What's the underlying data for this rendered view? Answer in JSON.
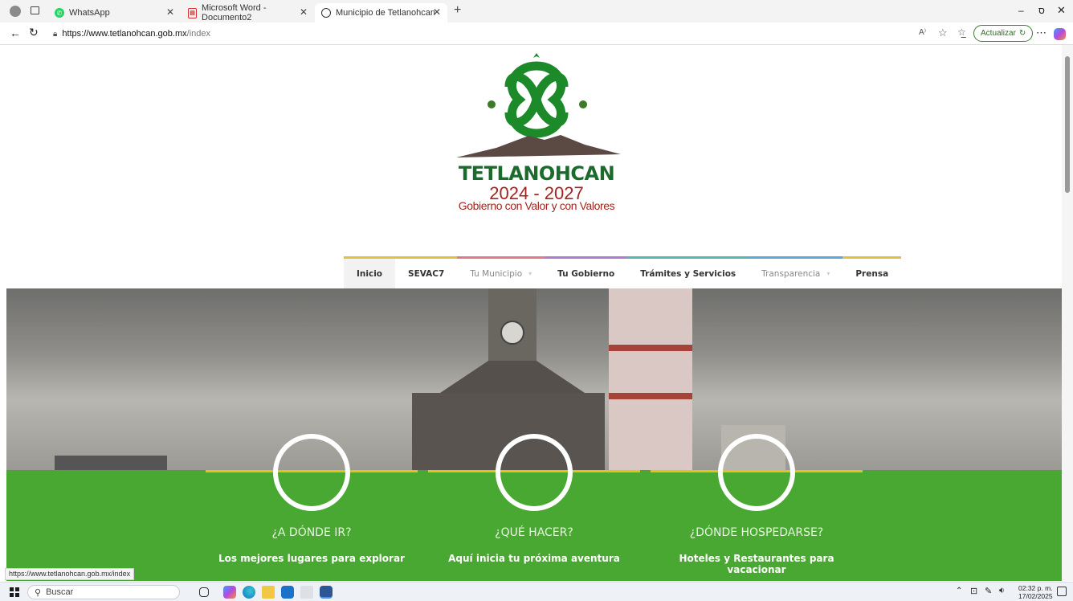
{
  "tabs": [
    {
      "title": "WhatsApp",
      "icon": "whatsapp-icon"
    },
    {
      "title": "Microsoft Word - Documento2",
      "icon": "pdf-icon"
    },
    {
      "title": "Municipio de Tetlanohcan",
      "icon": "globe-icon",
      "active": true
    }
  ],
  "address": {
    "host": "https://www.tetlanohcan.gob.mx",
    "path": "/index"
  },
  "toolbar": {
    "update_label": "Actualizar"
  },
  "logo": {
    "name": "TETLANOHCAN",
    "years": "2024 - 2027",
    "slogan": "Gobierno con Valor y con Valores"
  },
  "nav": [
    {
      "label": "Inicio",
      "color": "#e0c040"
    },
    {
      "label": "SEVAC7",
      "color": "#e0c040"
    },
    {
      "label": "Tu Municipio",
      "color": "#e07a8a",
      "dropdown": true
    },
    {
      "label": "Tu Gobierno",
      "color": "#b07ad0"
    },
    {
      "label": "Trámites y Servicios",
      "color": "#50b8b0"
    },
    {
      "label": "Transparencia",
      "color": "#5aa8d8",
      "dropdown": true
    },
    {
      "label": "Prensa",
      "color": "#e0c040"
    }
  ],
  "features": [
    {
      "title": "¿A DÓNDE IR?",
      "subtitle": "Los mejores lugares para explorar"
    },
    {
      "title": "¿QUÉ HACER?",
      "subtitle": "Aquí inicia tu próxima aventura"
    },
    {
      "title": "¿DÓNDE HOSPEDARSE?",
      "subtitle": "Hoteles y Restaurantes para vacacionar"
    }
  ],
  "status_url": "https://www.tetlanohcan.gob.mx/index",
  "taskbar": {
    "search_placeholder": "Buscar",
    "time": "02:32 p. m.",
    "date": "17/02/2025"
  },
  "colors": {
    "brand_green": "#1a6b2c",
    "brand_red": "#a3251f",
    "band_green": "#49a832",
    "accent_yellow": "#e3c21a"
  }
}
